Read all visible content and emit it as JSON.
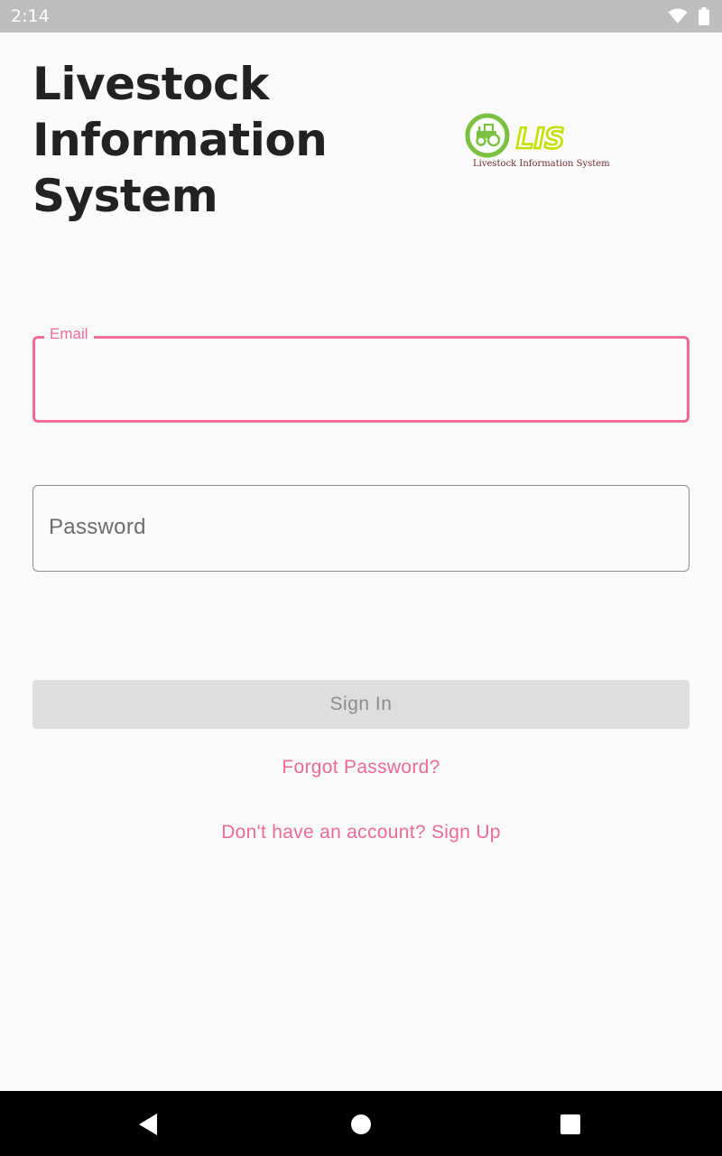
{
  "status_bar": {
    "time": "2:14",
    "icons": [
      "wifi-icon",
      "battery-icon"
    ]
  },
  "header": {
    "title_lines": [
      "Livestock",
      "Information",
      "System"
    ]
  },
  "logo": {
    "mark_text": "LIS",
    "tagline": "Livestock Information System",
    "colors": {
      "green": "#7cc242",
      "lime": "#c5e000",
      "maroon": "#6b2f33"
    }
  },
  "form": {
    "email_label": "Email",
    "email_value": "",
    "password_placeholder": "Password",
    "password_value": "",
    "signin_label": "Sign In"
  },
  "links": {
    "forgot_password": "Forgot Password?",
    "sign_up": "Don't have an account? Sign Up"
  },
  "navigation": {
    "buttons": [
      "back-icon",
      "home-icon",
      "recents-icon"
    ]
  },
  "theme": {
    "accent": "#f06b9b",
    "background": "#fafafa",
    "title_color": "#222222",
    "disabled_button": "#dedede"
  }
}
